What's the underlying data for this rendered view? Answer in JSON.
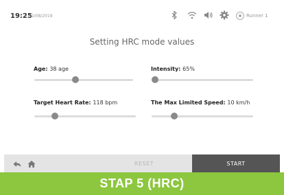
{
  "status_bar": {
    "time": "19:25",
    "date": "02/08/2019",
    "icons": [
      "bluetooth-icon",
      "wifi-icon",
      "volume-icon",
      "settings-icon"
    ],
    "user": {
      "icon": "user-icon",
      "name": "Runner 1"
    }
  },
  "title": "Setting HRC mode values",
  "fields": {
    "age": {
      "label": "Age",
      "value": "38 age",
      "level": 0.42
    },
    "intensity": {
      "label": "Intensity",
      "value": "65%",
      "level": 0.02
    },
    "target_hr": {
      "label": "Target Heart Rate",
      "value": "118 bpm",
      "level": 0.2
    },
    "max_speed": {
      "label": "The Max Limited Speed",
      "value": "10 km/h",
      "level": 0.22
    }
  },
  "bottom_bar": {
    "back_icon": "back-arrow-icon",
    "home_icon": "home-icon",
    "reset_label": "RESET",
    "start_label": "START"
  },
  "banner": "STAP 5 (HRC)",
  "colors": {
    "banner": "#8dc63f",
    "start_button": "#555555",
    "slider_thumb": "#8a8a8a"
  }
}
